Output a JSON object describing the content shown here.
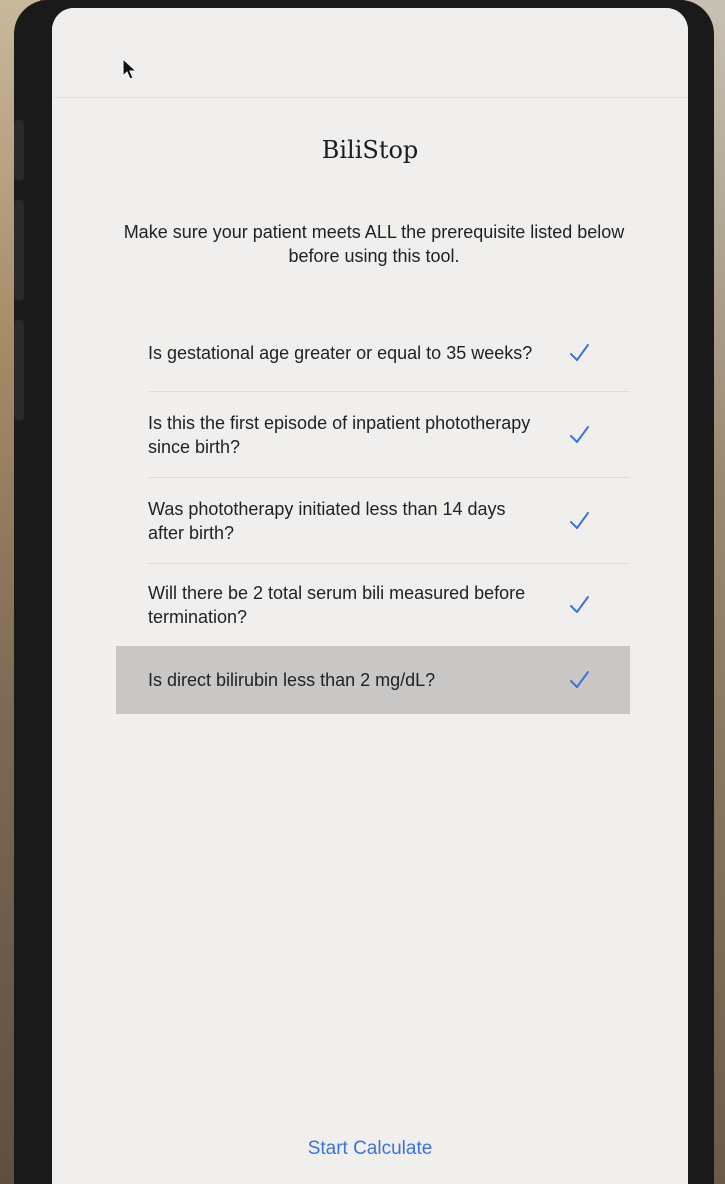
{
  "app": {
    "title": "BiliStop"
  },
  "intro": {
    "text": "Make sure your patient meets ALL the prerequisite listed below before using this tool."
  },
  "prerequisites": [
    {
      "question": "Is gestational age greater or equal to 35 weeks?",
      "checked": true,
      "highlighted": false
    },
    {
      "question": "Is this the first episode of inpatient phototherapy since birth?",
      "checked": true,
      "highlighted": false
    },
    {
      "question": "Was phototherapy initiated less than 14 days after birth?",
      "checked": true,
      "highlighted": false
    },
    {
      "question": "Will there be 2 total serum bili measured before termination?",
      "checked": true,
      "highlighted": false
    },
    {
      "question": "Is direct bilirubin less than 2 mg/dL?",
      "checked": true,
      "highlighted": true
    }
  ],
  "footer": {
    "start_label": "Start Calculate"
  },
  "colors": {
    "accent": "#3e72d8",
    "highlight_row": "#c8c7c6",
    "screen_bg": "#f0efed"
  },
  "icons": {
    "check": "checkmark-icon",
    "cursor": "mouse-pointer-icon"
  }
}
